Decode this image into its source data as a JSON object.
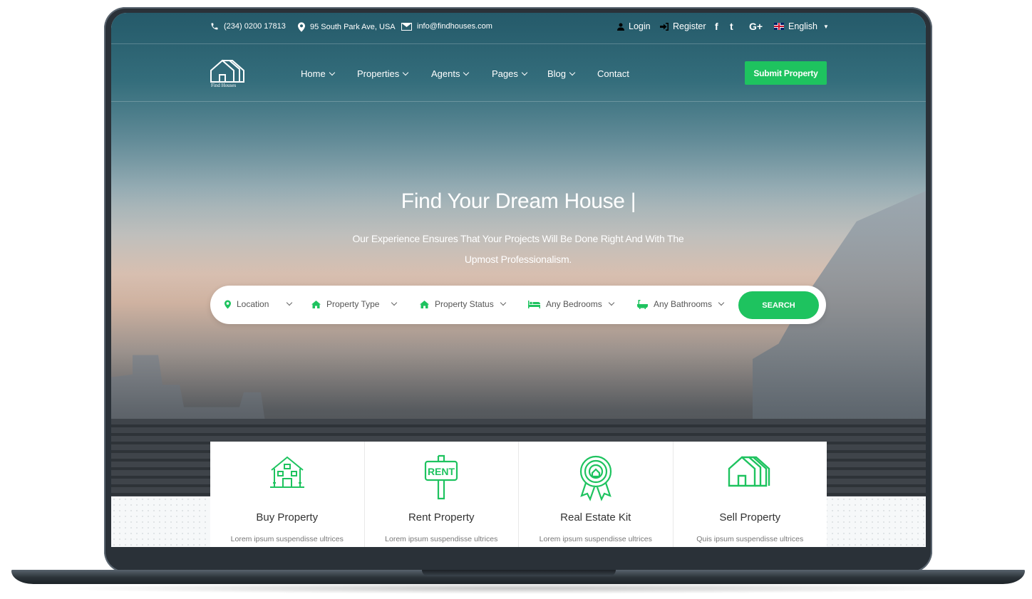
{
  "topbar": {
    "phone": "(234) 0200 17813",
    "address": "95 South Park Ave, USA",
    "email": "info@findhouses.com",
    "login": "Login",
    "register": "Register",
    "social": [
      "f",
      "t",
      "G+"
    ],
    "language": "English"
  },
  "nav": {
    "logo_text": "Find Houses",
    "items": [
      {
        "label": "Home"
      },
      {
        "label": "Properties"
      },
      {
        "label": "Agents"
      },
      {
        "label": "Pages"
      },
      {
        "label": "Blog"
      },
      {
        "label": "Contact"
      }
    ],
    "submit": "Submit Property"
  },
  "hero": {
    "title": "Find Your Dream House |",
    "subtitle": "Our Experience Ensures That Your Projects Will Be Done Right And With The Upmost Professionalism."
  },
  "search": {
    "fields": [
      {
        "label": "Location",
        "icon": "map-pin-icon"
      },
      {
        "label": "Property Type",
        "icon": "home-icon"
      },
      {
        "label": "Property Status",
        "icon": "home-icon"
      },
      {
        "label": "Any Bedrooms",
        "icon": "bed-icon"
      },
      {
        "label": "Any Bathrooms",
        "icon": "bath-icon"
      }
    ],
    "button": "SEARCH"
  },
  "features": [
    {
      "title": "Buy Property",
      "desc": "Lorem ipsum suspendisse ultrices",
      "icon": "buy-house-icon"
    },
    {
      "title": "Rent Property",
      "desc": "Lorem ipsum suspendisse ultrices",
      "icon": "rent-sign-icon"
    },
    {
      "title": "Real Estate Kit",
      "desc": "Lorem ipsum suspendisse ultrices",
      "icon": "badge-icon"
    },
    {
      "title": "Sell Property",
      "desc": "Quis ipsum suspendisse ultrices",
      "icon": "sell-house-icon"
    }
  ],
  "colors": {
    "accent": "#1ec35f",
    "header_teal": "#2e6575"
  }
}
